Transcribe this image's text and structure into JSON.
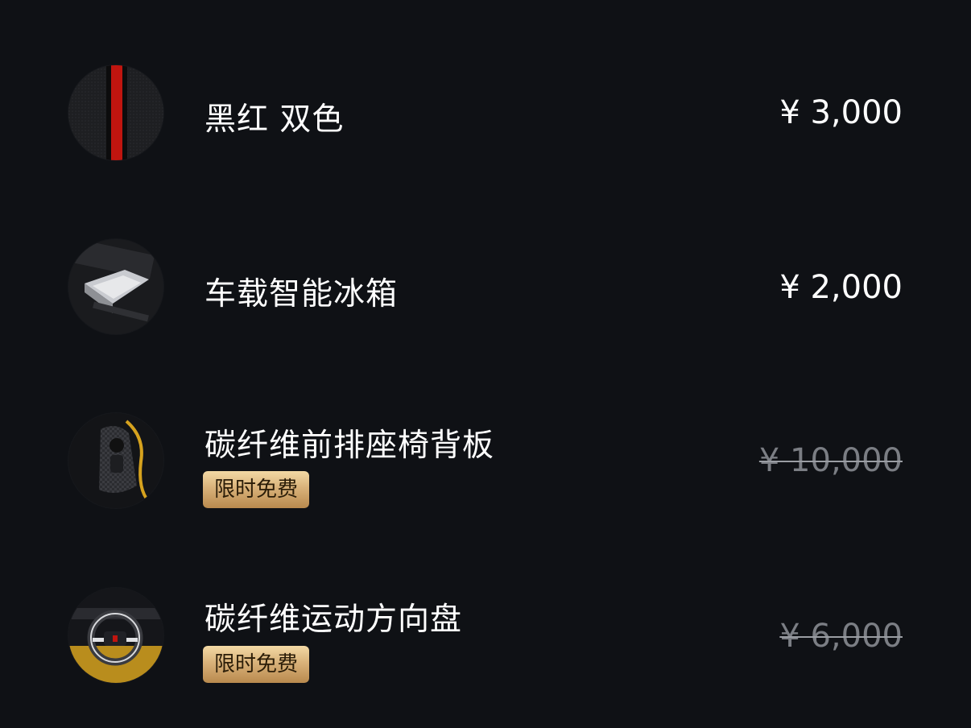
{
  "items": [
    {
      "title": "黑红 双色",
      "price": "¥ 3,000",
      "original_price_struck": false,
      "badge": ""
    },
    {
      "title": "车载智能冰箱",
      "price": "¥ 2,000",
      "original_price_struck": false,
      "badge": ""
    },
    {
      "title": "碳纤维前排座椅背板",
      "price": "¥ 10,000",
      "original_price_struck": true,
      "badge": "限时免费"
    },
    {
      "title": "碳纤维运动方向盘",
      "price": "¥ 6,000",
      "original_price_struck": true,
      "badge": "限时免费"
    }
  ],
  "colors": {
    "background": "#0f1115",
    "badge_gold": "#d9b27a",
    "accent_red": "#c0150f",
    "accent_yellow": "#d6a21e"
  }
}
